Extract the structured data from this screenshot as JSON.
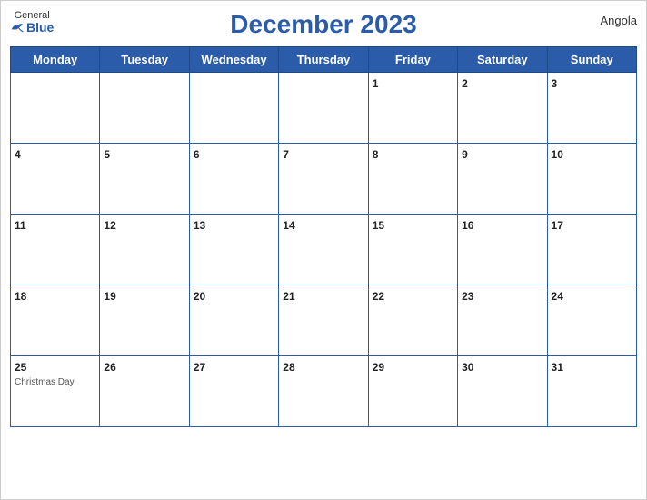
{
  "header": {
    "logo_general": "General",
    "logo_blue": "Blue",
    "title": "December 2023",
    "country": "Angola"
  },
  "weekdays": [
    "Monday",
    "Tuesday",
    "Wednesday",
    "Thursday",
    "Friday",
    "Saturday",
    "Sunday"
  ],
  "weeks": [
    [
      {
        "day": null,
        "holiday": ""
      },
      {
        "day": null,
        "holiday": ""
      },
      {
        "day": null,
        "holiday": ""
      },
      {
        "day": null,
        "holiday": ""
      },
      {
        "day": 1,
        "holiday": ""
      },
      {
        "day": 2,
        "holiday": ""
      },
      {
        "day": 3,
        "holiday": ""
      }
    ],
    [
      {
        "day": 4,
        "holiday": ""
      },
      {
        "day": 5,
        "holiday": ""
      },
      {
        "day": 6,
        "holiday": ""
      },
      {
        "day": 7,
        "holiday": ""
      },
      {
        "day": 8,
        "holiday": ""
      },
      {
        "day": 9,
        "holiday": ""
      },
      {
        "day": 10,
        "holiday": ""
      }
    ],
    [
      {
        "day": 11,
        "holiday": ""
      },
      {
        "day": 12,
        "holiday": ""
      },
      {
        "day": 13,
        "holiday": ""
      },
      {
        "day": 14,
        "holiday": ""
      },
      {
        "day": 15,
        "holiday": ""
      },
      {
        "day": 16,
        "holiday": ""
      },
      {
        "day": 17,
        "holiday": ""
      }
    ],
    [
      {
        "day": 18,
        "holiday": ""
      },
      {
        "day": 19,
        "holiday": ""
      },
      {
        "day": 20,
        "holiday": ""
      },
      {
        "day": 21,
        "holiday": ""
      },
      {
        "day": 22,
        "holiday": ""
      },
      {
        "day": 23,
        "holiday": ""
      },
      {
        "day": 24,
        "holiday": ""
      }
    ],
    [
      {
        "day": 25,
        "holiday": "Christmas Day"
      },
      {
        "day": 26,
        "holiday": ""
      },
      {
        "day": 27,
        "holiday": ""
      },
      {
        "day": 28,
        "holiday": ""
      },
      {
        "day": 29,
        "holiday": ""
      },
      {
        "day": 30,
        "holiday": ""
      },
      {
        "day": 31,
        "holiday": ""
      }
    ]
  ]
}
